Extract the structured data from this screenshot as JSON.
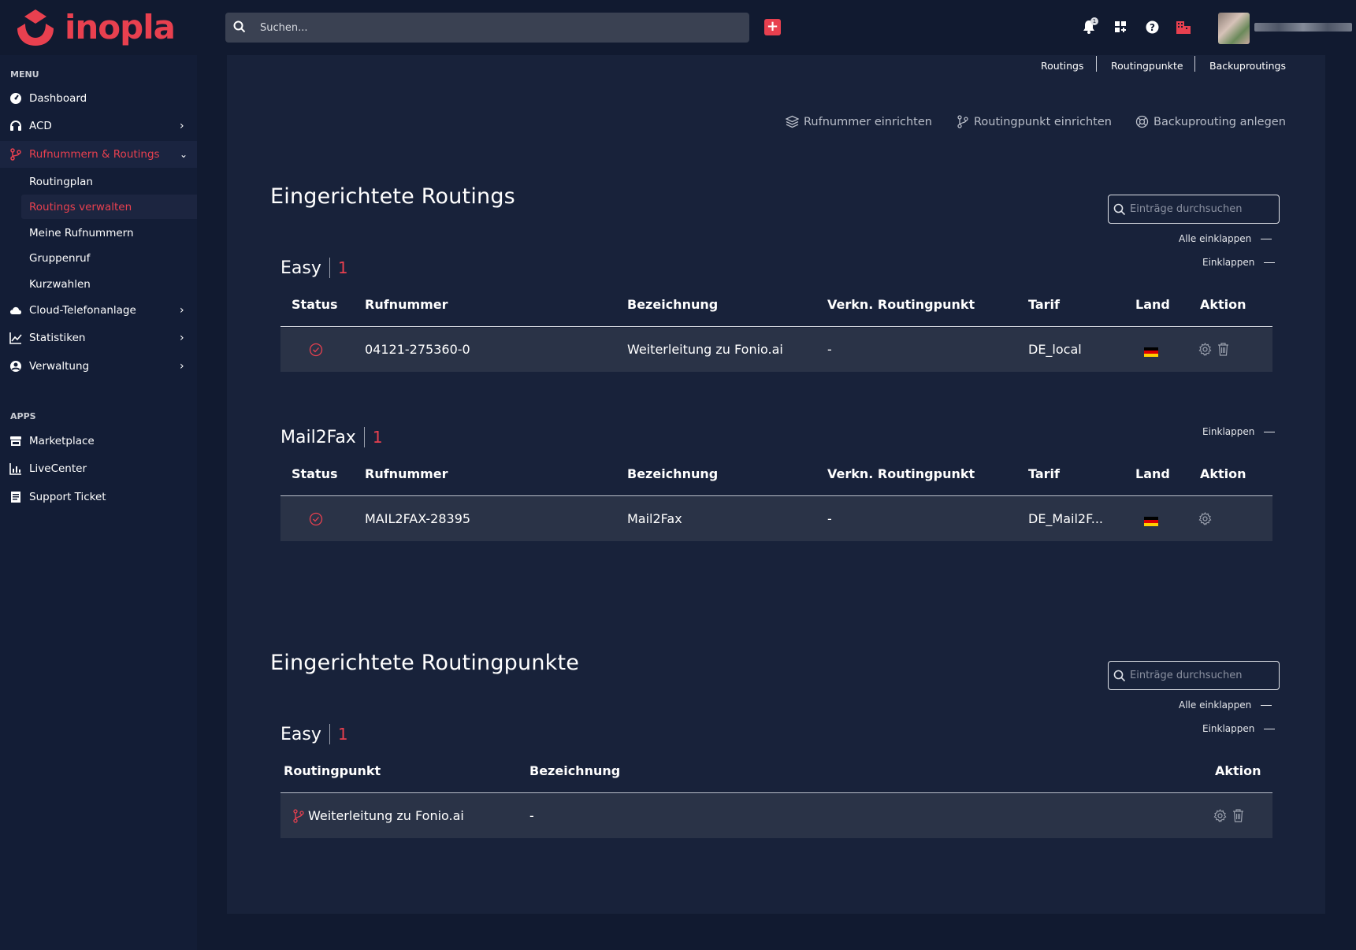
{
  "brand": {
    "name": "inopla"
  },
  "search": {
    "placeholder": "Suchen..."
  },
  "header": {
    "notification_count": "1"
  },
  "sidebar": {
    "menu_label": "MENU",
    "apps_label": "APPS",
    "items": [
      {
        "label": "Dashboard"
      },
      {
        "label": "ACD"
      },
      {
        "label": "Rufnummern & Routings"
      },
      {
        "label": "Cloud-Telefonanlage"
      },
      {
        "label": "Statistiken"
      },
      {
        "label": "Verwaltung"
      }
    ],
    "subitems": [
      {
        "label": "Routingplan"
      },
      {
        "label": "Routings verwalten"
      },
      {
        "label": "Meine Rufnummern"
      },
      {
        "label": "Gruppenruf"
      },
      {
        "label": "Kurzwahlen"
      }
    ],
    "apps": [
      {
        "label": "Marketplace"
      },
      {
        "label": "LiveCenter"
      },
      {
        "label": "Support Ticket"
      }
    ]
  },
  "top_links": [
    "Routings",
    "Routingpunkte",
    "Backuproutings"
  ],
  "actions": {
    "setup_number": "Rufnummer einrichten",
    "setup_routingpoint": "Routingpunkt einrichten",
    "create_backup": "Backuprouting anlegen"
  },
  "routings": {
    "title": "Eingerichtete Routings",
    "filter_placeholder": "Einträge durchsuchen",
    "collapse_all": "Alle einklappen",
    "collapse": "Einklappen",
    "columns": [
      "Status",
      "Rufnummer",
      "Bezeichnung",
      "Verkn. Routingpunkt",
      "Tarif",
      "Land",
      "Aktion"
    ],
    "groups": [
      {
        "name": "Easy",
        "count": "1",
        "rows": [
          {
            "number": "04121-275360-0",
            "label": "Weiterleitung zu Fonio.ai",
            "routingpoint": "-",
            "tariff": "DE_local"
          }
        ]
      },
      {
        "name": "Mail2Fax",
        "count": "1",
        "rows": [
          {
            "number": "MAIL2FAX-28395",
            "label": "Mail2Fax",
            "routingpoint": "-",
            "tariff": "DE_Mail2F..."
          }
        ]
      }
    ]
  },
  "routingpoints": {
    "title": "Eingerichtete Routingpunkte",
    "filter_placeholder": "Einträge durchsuchen",
    "collapse_all": "Alle einklappen",
    "collapse": "Einklappen",
    "columns": [
      "Routingpunkt",
      "Bezeichnung",
      "Aktion"
    ],
    "groups": [
      {
        "name": "Easy",
        "count": "1",
        "rows": [
          {
            "name": "Weiterleitung zu Fonio.ai",
            "label": "-"
          }
        ]
      }
    ]
  },
  "colors": {
    "accent": "#e8404f",
    "background": "#111a30",
    "card": "#18223a",
    "row": "#2a3347"
  }
}
